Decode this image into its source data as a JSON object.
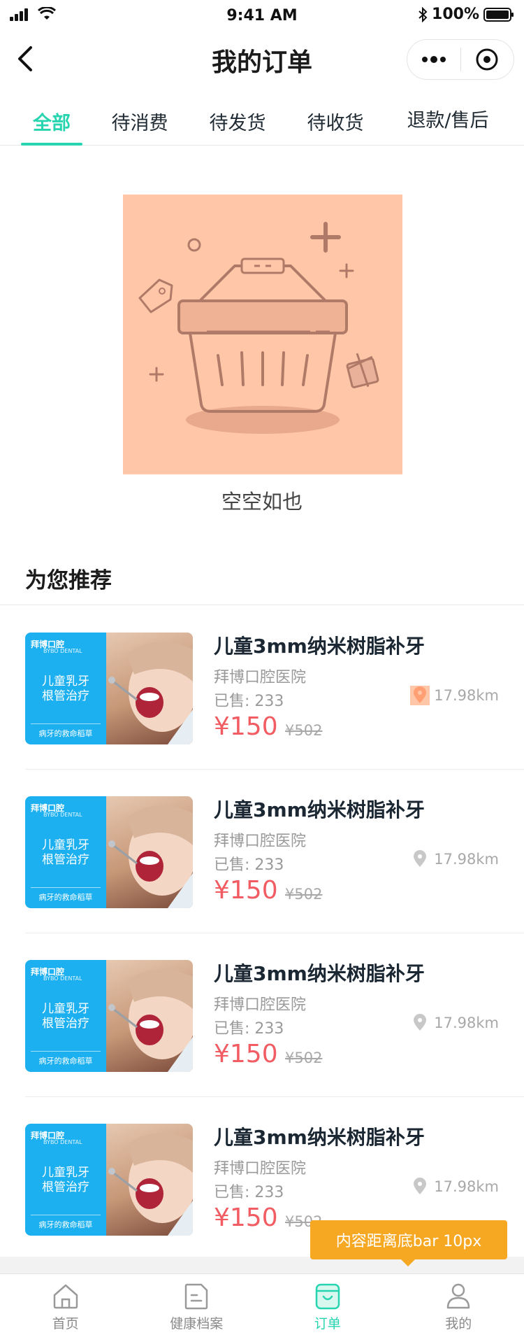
{
  "status_bar": {
    "time": "9:41 AM",
    "battery": "100%"
  },
  "nav": {
    "title": "我的订单"
  },
  "tabs": [
    {
      "label": "全部",
      "active": true
    },
    {
      "label": "待消费",
      "active": false
    },
    {
      "label": "待发货",
      "active": false
    },
    {
      "label": "待收货",
      "active": false
    },
    {
      "label": "退款/售后",
      "active": false
    }
  ],
  "empty": {
    "text": "空空如也"
  },
  "recommend": {
    "title": "为您推荐",
    "items": [
      {
        "title": "儿童3mm纳米树脂补牙",
        "shop": "拜博口腔医院",
        "sold": "已售: 233",
        "distance": "17.98km",
        "price": "¥150",
        "original_price": "¥502",
        "thumb_brand": "拜博口腔",
        "thumb_brand_en": "BYBO DENTAL",
        "thumb_main_1": "儿童乳牙",
        "thumb_main_2": "根管治疗",
        "thumb_sub": "病牙的救命稻草",
        "pin_color": "#ffb08a"
      },
      {
        "title": "儿童3mm纳米树脂补牙",
        "shop": "拜博口腔医院",
        "sold": "已售: 233",
        "distance": "17.98km",
        "price": "¥150",
        "original_price": "¥502",
        "thumb_brand": "拜博口腔",
        "thumb_brand_en": "BYBO DENTAL",
        "thumb_main_1": "儿童乳牙",
        "thumb_main_2": "根管治疗",
        "thumb_sub": "病牙的救命稻草",
        "pin_color": "#c8c8c8"
      },
      {
        "title": "儿童3mm纳米树脂补牙",
        "shop": "拜博口腔医院",
        "sold": "已售: 233",
        "distance": "17.98km",
        "price": "¥150",
        "original_price": "¥502",
        "thumb_brand": "拜博口腔",
        "thumb_brand_en": "BYBO DENTAL",
        "thumb_main_1": "儿童乳牙",
        "thumb_main_2": "根管治疗",
        "thumb_sub": "病牙的救命稻草",
        "pin_color": "#c8c8c8"
      },
      {
        "title": "儿童3mm纳米树脂补牙",
        "shop": "拜博口腔医院",
        "sold": "已售: 233",
        "distance": "17.98km",
        "price": "¥150",
        "original_price": "¥502",
        "thumb_brand": "拜博口腔",
        "thumb_brand_en": "BYBO DENTAL",
        "thumb_main_1": "儿童乳牙",
        "thumb_main_2": "根管治疗",
        "thumb_sub": "病牙的救命稻草",
        "pin_color": "#c8c8c8"
      }
    ]
  },
  "tooltip": {
    "text": "内容距离底bar  10px"
  },
  "tabbar": [
    {
      "label": "首页",
      "icon": "home-icon",
      "active": false
    },
    {
      "label": "健康档案",
      "icon": "document-icon",
      "active": false
    },
    {
      "label": "订单",
      "icon": "order-bag-icon",
      "active": true
    },
    {
      "label": "我的",
      "icon": "person-icon",
      "active": false
    }
  ],
  "colors": {
    "accent": "#26d5b0",
    "price": "#f25c63",
    "tooltip": "#f7a823",
    "illustration_bg": "#ffc7a8"
  }
}
